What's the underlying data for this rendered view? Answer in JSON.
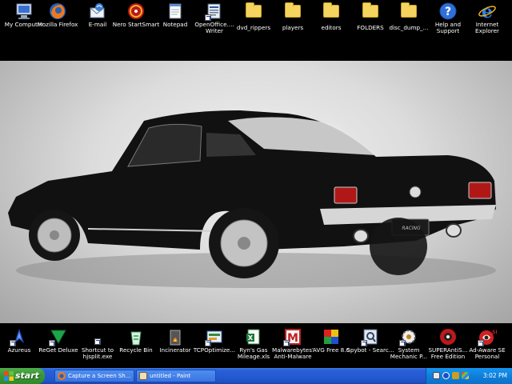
{
  "desktop": {
    "top_icons": [
      {
        "label": "My Computer",
        "icon": "computer-icon"
      },
      {
        "label": "Mozilla Firefox",
        "icon": "firefox-icon"
      },
      {
        "label": "E-mail",
        "icon": "email-icon"
      },
      {
        "label": "Nero StartSmart",
        "icon": "nero-icon"
      },
      {
        "label": "Notepad",
        "icon": "notepad-icon"
      },
      {
        "label": "OpenOffice.... Writer",
        "icon": "openoffice-writer-icon"
      },
      {
        "label": "dvd_rippers",
        "icon": "folder-icon"
      },
      {
        "label": "players",
        "icon": "folder-icon"
      },
      {
        "label": "editors",
        "icon": "folder-icon"
      },
      {
        "label": "FOLDERS",
        "icon": "folder-icon"
      },
      {
        "label": "disc_dump_...",
        "icon": "folder-icon"
      },
      {
        "label": "Help and Support",
        "icon": "help-icon"
      },
      {
        "label": "Internet Explorer",
        "icon": "internet-explorer-icon"
      }
    ],
    "bottom_icons": [
      {
        "label": "Azureus",
        "icon": "azureus-icon"
      },
      {
        "label": "ReGet Deluxe",
        "icon": "reget-icon"
      },
      {
        "label": "Shortcut to hjsplit.exe",
        "icon": "hjsplit-shortcut-icon"
      },
      {
        "label": "Recycle Bin",
        "icon": "recycle-bin-icon"
      },
      {
        "label": "Incinerator",
        "icon": "incinerator-icon"
      },
      {
        "label": "TCPOptimize...",
        "icon": "tcpoptimizer-icon"
      },
      {
        "label": "Ryn's Gas Mileage.xls",
        "icon": "excel-file-icon"
      },
      {
        "label": "Malwarebytes' Anti-Malware",
        "icon": "malwarebytes-icon"
      },
      {
        "label": "AVG Free 8.0",
        "icon": "avg-icon"
      },
      {
        "label": "Spybot - Searc...",
        "icon": "spybot-icon"
      },
      {
        "label": "System Mechanic P...",
        "icon": "system-mechanic-icon"
      },
      {
        "label": "SUPERAntiS... Free Edition",
        "icon": "superantispyware-icon"
      },
      {
        "label": "Ad-Aware SE Personal",
        "icon": "adaware-icon"
      }
    ],
    "wallpaper_badge": "RACING"
  },
  "taskbar": {
    "start_label": "start",
    "tasks": [
      {
        "label": "Capture a Screen Sh...",
        "icon": "firefox-icon"
      },
      {
        "label": "untitled - Paint",
        "icon": "paint-icon"
      }
    ],
    "clock": "3:02 PM"
  },
  "colors": {
    "taskbar_blue": "#245ad2",
    "start_green": "#3c9a36",
    "tray_blue": "#0f7fdc"
  }
}
